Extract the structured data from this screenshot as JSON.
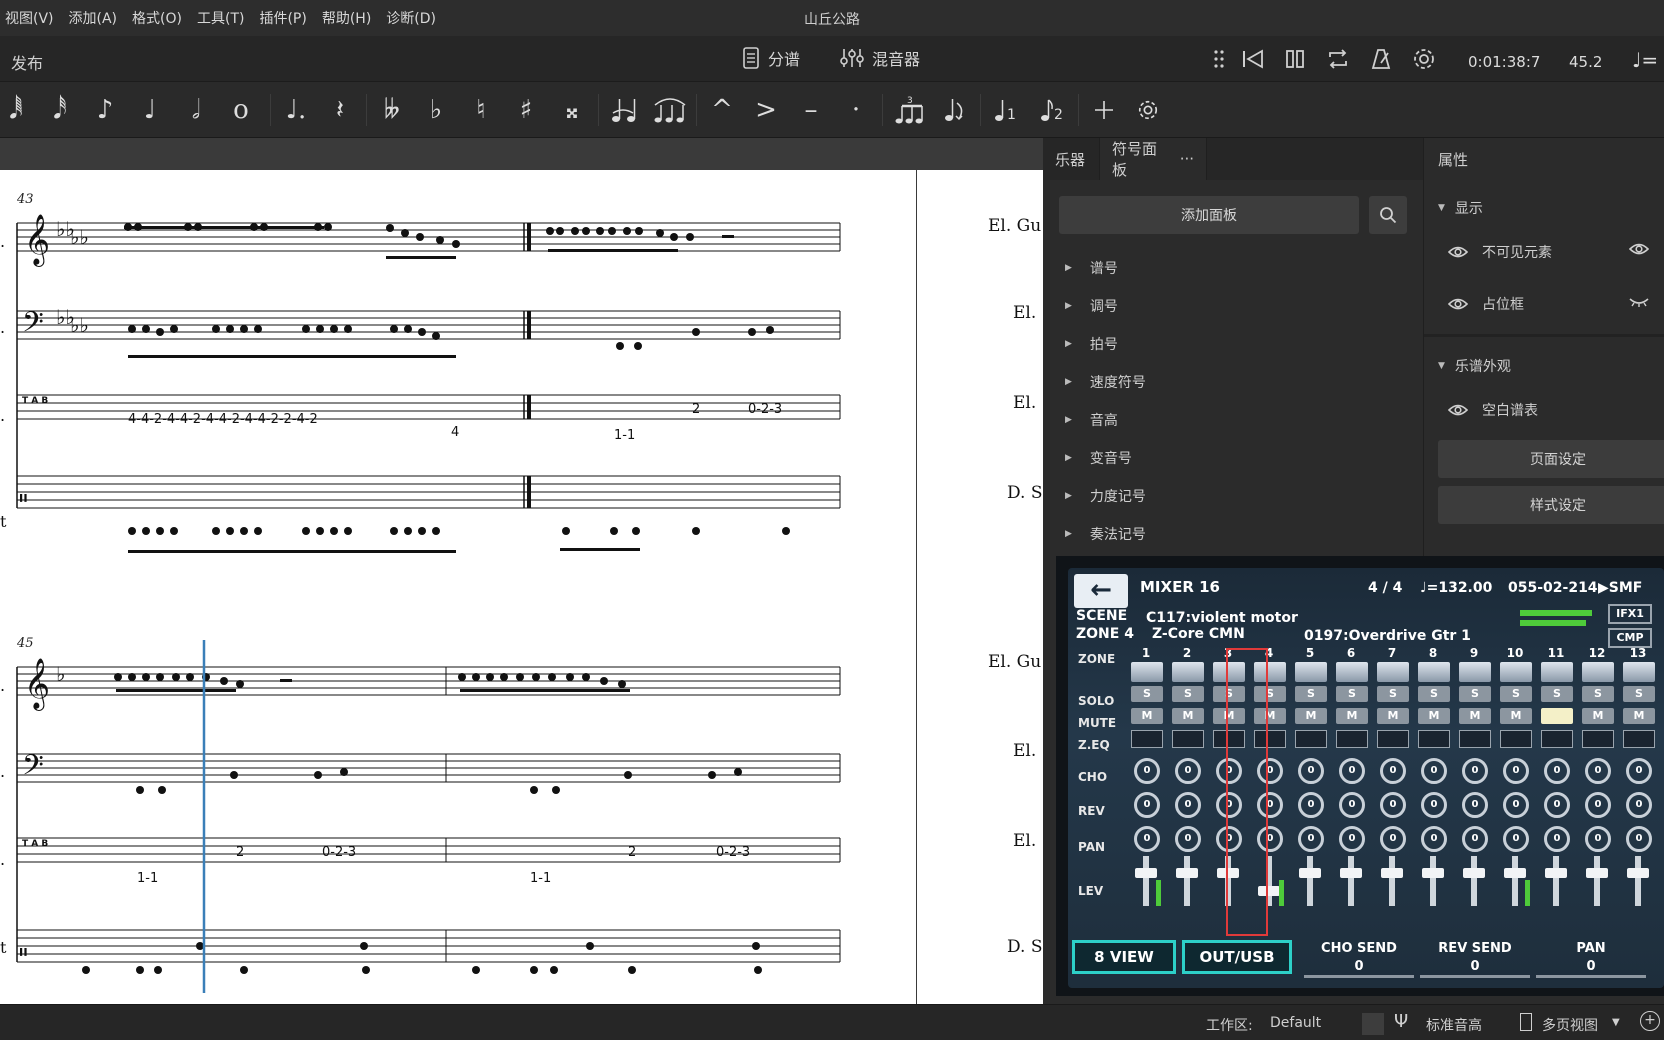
{
  "menu": [
    "视图(V)",
    "添加(A)",
    "格式(O)",
    "工具(T)",
    "插件(P)",
    "帮助(H)",
    "诊断(D)"
  ],
  "app_title": "山丘公路",
  "tabbar": {
    "publish": "发布",
    "parts": "分谱",
    "mixer": "混音器",
    "time": "0:01:38:7",
    "tempo": "45.2",
    "tempo_note": "♩="
  },
  "note_toolbar": [
    "sixty-fourth-note",
    "thirty-second-note",
    "eighth-note",
    "quarter-note",
    "half-note",
    "whole-note",
    "dotted-note",
    "rest",
    "double-flat",
    "flat",
    "natural",
    "sharp",
    "double-sharp",
    "tie",
    "slur",
    "marcato",
    "accent",
    "tenuto",
    "staccato",
    "tuplet",
    "flip",
    "voice-1",
    "voice-2",
    "add",
    "customize"
  ],
  "score": {
    "measure_numbers": [
      "43",
      "45"
    ],
    "page2_labels": [
      "El. Gu",
      "El.",
      "El.",
      "D. S",
      "El. Gu",
      "El.",
      "El.",
      "D. S"
    ],
    "cut_labels": [
      ".",
      ".",
      ".",
      "t",
      ".",
      ".",
      ".",
      "t"
    ],
    "tab_row1_left": "4-4-2-4-4-2-4-4-2-4-4-2-2-4-2",
    "tab_row1_low": "4",
    "tab_row1_right_mid": "1-1",
    "tab_row1_right_hi": "2",
    "tab_row1_right_hi2": "0-2-3",
    "tab_row2_a": "1-1",
    "tab_row2_b": "2",
    "tab_row2_c": "0-2-3",
    "tab_row2_d": "1-1",
    "tab_row2_e": "2",
    "tab_row2_f": "0-2-3",
    "tab_clef": "T A B"
  },
  "palette": {
    "tabs": [
      "乐器",
      "符号面板",
      "···"
    ],
    "add_panel": "添加面板",
    "items": [
      "谱号",
      "调号",
      "拍号",
      "速度符号",
      "音高",
      "变音号",
      "力度记号",
      "奏法记号"
    ]
  },
  "properties": {
    "title": "属性",
    "section_display": "显示",
    "invisible": "不可见元素",
    "placeholder": "占位框",
    "section_appearance": "乐谱外观",
    "blank_staff": "空白谱表",
    "page_settings": "页面设定",
    "style_settings": "样式设定"
  },
  "mixer_photo": {
    "title": "MIXER 16",
    "meter": "4 / 4",
    "tempo": "♩=132.00",
    "position": "055-02-214",
    "smf": "▶SMF",
    "scene_label": "SCENE",
    "scene_value": "C117:violent motor",
    "zone_label": "ZONE 4",
    "zone_value": "Z-Core CMN",
    "program": "0197:Overdrive Gtr 1",
    "ifx": "IFX1",
    "cmp": "CMP",
    "row_labels": [
      "ZONE",
      "SOLO",
      "MUTE",
      "Z.EQ",
      "CHO",
      "REV",
      "PAN",
      "LEV"
    ],
    "channels": [
      "1",
      "2",
      "3",
      "4",
      "5",
      "6",
      "7",
      "8",
      "9",
      "10",
      "11",
      "12",
      "13"
    ],
    "s": "S",
    "m": "M",
    "knob_zero": "0",
    "btn_8view": "8 VIEW",
    "btn_outusb": "OUT/USB",
    "cho_send": "CHO SEND",
    "cho_send_val": "0",
    "rev_send": "REV SEND",
    "rev_send_val": "0",
    "pan": "PAN",
    "pan_val": "0"
  },
  "statusbar": {
    "workspace_label": "工作区:",
    "workspace_value": "Default",
    "pitch": "标准音高",
    "view": "多页视图"
  }
}
